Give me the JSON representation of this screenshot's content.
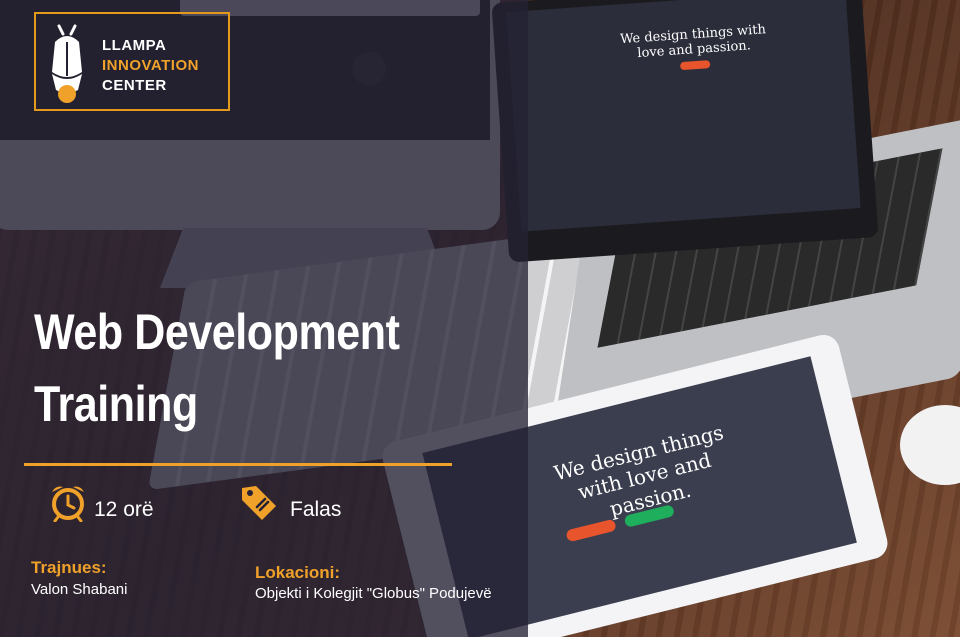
{
  "logo": {
    "line1": "LLAMPA",
    "line2": "INNOVATION",
    "line3": "CENTER"
  },
  "title": {
    "line1": "Web Development",
    "line2": "Training"
  },
  "duration": {
    "icon": "alarm-clock-icon",
    "text": "12 orë"
  },
  "price": {
    "icon": "price-tag-icon",
    "text": "Falas"
  },
  "trainer": {
    "label": "Trajnues:",
    "value": "Valon Shabani"
  },
  "location": {
    "label": "Lokacioni:",
    "value": "Objekti i Kolegjit \"Globus\" Podujevë"
  },
  "background": {
    "laptop_text": "We design things with love and passion.",
    "tablet_text": "We design things with love and passion."
  },
  "colors": {
    "accent": "#f0a12a",
    "overlay": "#242134",
    "text": "#ffffff"
  }
}
